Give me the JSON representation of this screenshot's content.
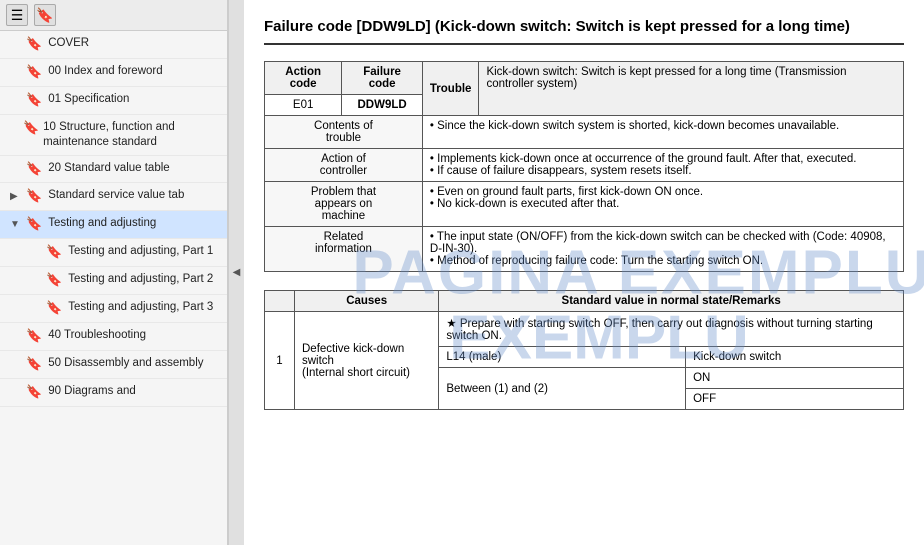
{
  "sidebar": {
    "toolbar": {
      "menu_icon": "☰",
      "bookmark_icon": "🔖"
    },
    "items": [
      {
        "id": "cover",
        "label": "COVER",
        "indent": 0,
        "expandable": false
      },
      {
        "id": "00-index",
        "label": "00 Index and foreword",
        "indent": 0,
        "expandable": false
      },
      {
        "id": "01-spec",
        "label": "01 Specification",
        "indent": 0,
        "expandable": false
      },
      {
        "id": "10-structure",
        "label": "10 Structure, function and maintenance standard",
        "indent": 0,
        "expandable": false
      },
      {
        "id": "20-standard",
        "label": "20 Standard value table",
        "indent": 0,
        "expandable": false
      },
      {
        "id": "standard-service",
        "label": "Standard service value tab",
        "indent": 0,
        "expandable": true
      },
      {
        "id": "testing-adj",
        "label": "Testing and adjusting",
        "indent": 0,
        "expandable": true,
        "active": true
      },
      {
        "id": "testing-adj-1",
        "label": "Testing and adjusting, Part 1",
        "indent": 1,
        "expandable": false
      },
      {
        "id": "testing-adj-2",
        "label": "Testing and adjusting, Part 2",
        "indent": 1,
        "expandable": false
      },
      {
        "id": "testing-adj-3",
        "label": "Testing and adjusting, Part 3",
        "indent": 1,
        "expandable": false
      },
      {
        "id": "40-troubleshoot",
        "label": "40 Troubleshooting",
        "indent": 0,
        "expandable": false
      },
      {
        "id": "50-disassembly",
        "label": "50 Disassembly and assembly",
        "indent": 0,
        "expandable": false
      },
      {
        "id": "90-diagrams",
        "label": "90 Diagrams and",
        "indent": 0,
        "expandable": false
      }
    ]
  },
  "main": {
    "title": "Failure code [DDW9LD] (Kick-down switch: Switch is kept pressed for a long time)",
    "table1": {
      "headers": [
        "Action code",
        "Failure code",
        "Trouble"
      ],
      "action_code": "E01",
      "failure_code": "DDW9LD",
      "trouble_desc": "Kick-down switch: Switch is kept pressed for a long time (Transmission controller system)",
      "rows": [
        {
          "label": "Contents of trouble",
          "content": "• Since the kick-down switch system is shorted, kick-down becomes unavailable."
        },
        {
          "label": "Action of controller",
          "content": "• Implements kick-down once at occurrence of the ground fault. After that, executed.\n• If cause of failure disappears, system resets itself."
        },
        {
          "label": "Problem that appears on machine",
          "content": "• Even on ground fault parts, first kick-down ON once.\n• No kick-down is executed after that."
        },
        {
          "label": "Related information",
          "content": "• The input state (ON/OFF) from the kick-down switch can be checked with (Code: 40908, D-IN-30).\n• Method of reproducing failure code: Turn the starting switch ON."
        }
      ]
    },
    "table2": {
      "headers": [
        "Causes",
        "Standard value in normal state/Remarks"
      ],
      "rows": [
        {
          "num": "1",
          "cause": "Defective kick-down switch (Internal short circuit)",
          "sub_rows": [
            {
              "label": "★ Prepare with starting switch OFF, then carry out diagnosis without turning starting switch ON.",
              "connector": "",
              "value": ""
            },
            {
              "connector": "L14 (male)",
              "value": "Kick-down switch"
            },
            {
              "connector": "Between (1) and (2)",
              "sub": "ON",
              "value": ""
            },
            {
              "connector": "",
              "sub": "OFF",
              "value": ""
            }
          ]
        }
      ]
    }
  },
  "watermark": {
    "line1": "PAGINA EXEMPLU",
    "line2": "EXEMPLU"
  },
  "collapse_handle": "◀"
}
